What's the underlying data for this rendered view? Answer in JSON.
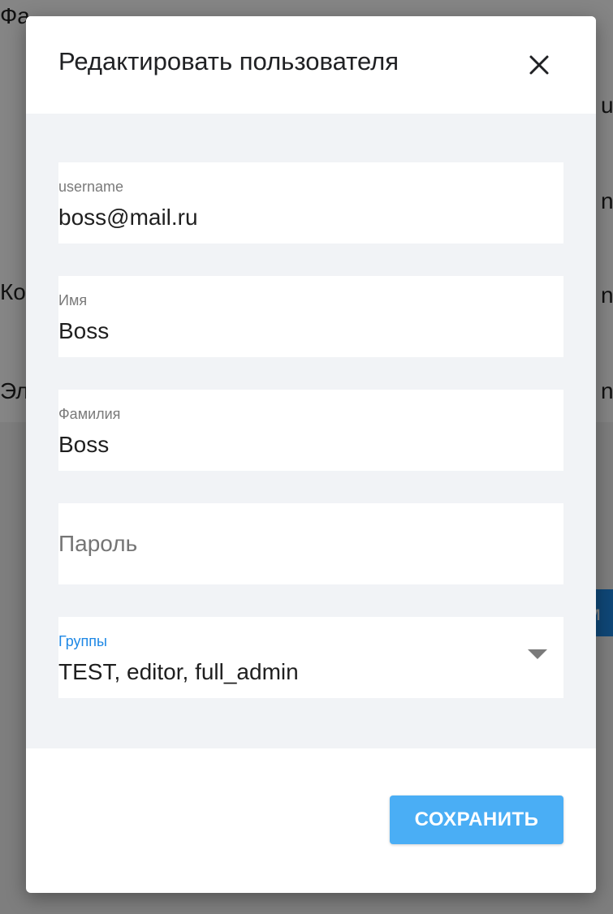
{
  "background": {
    "fragments": [
      "Фа",
      "Ко",
      "Эл",
      "u",
      "n",
      "n",
      "n",
      "м"
    ]
  },
  "dialog": {
    "title": "Редактировать пользователя",
    "close_icon": "close-icon",
    "fields": {
      "username": {
        "label": "username",
        "value": "boss@mail.ru"
      },
      "first_name": {
        "label": "Имя",
        "value": "Boss"
      },
      "last_name": {
        "label": "Фамилия",
        "value": "Boss"
      },
      "password": {
        "placeholder": "Пароль",
        "value": ""
      },
      "groups": {
        "label": "Группы",
        "value": "TEST, editor, full_admin",
        "icon": "chevron-down-icon"
      }
    },
    "save_label": "СОХРАНИТЬ"
  },
  "colors": {
    "accent": "#1e88e5",
    "save_button": "#4aaef5",
    "body_background": "#f1f3f6",
    "overlay": "#000000"
  }
}
